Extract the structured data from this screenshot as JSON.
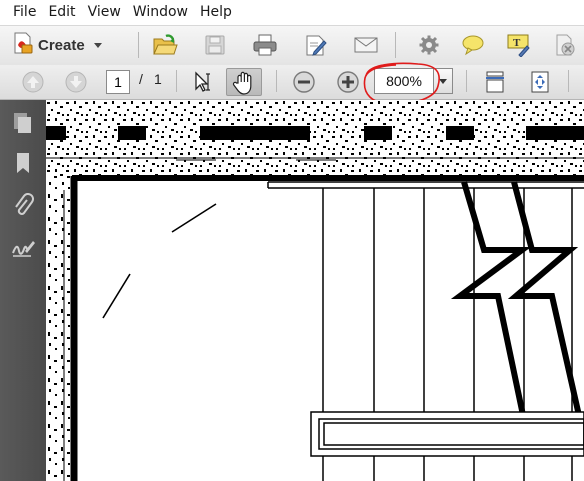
{
  "menu": [
    "File",
    "Edit",
    "View",
    "Window",
    "Help"
  ],
  "toolbar": {
    "create_label": "Create",
    "icons": [
      "open-icon",
      "save-icon",
      "print-icon",
      "edit-icon",
      "email-icon",
      "gear-icon",
      "comment-icon",
      "highlight-icon",
      "delete-icon"
    ]
  },
  "nav": {
    "page_current": "1",
    "page_separator": "/",
    "page_total": "1",
    "zoom_value": "800%"
  },
  "sidebar": {
    "icons": [
      "pages-icon",
      "bookmark-icon",
      "attachment-icon",
      "signature-icon"
    ]
  },
  "colors": {
    "annotation_red": "#e01b1b",
    "sidebar_bg": "#555555",
    "toolbar_bg": "#e8e8e8"
  }
}
